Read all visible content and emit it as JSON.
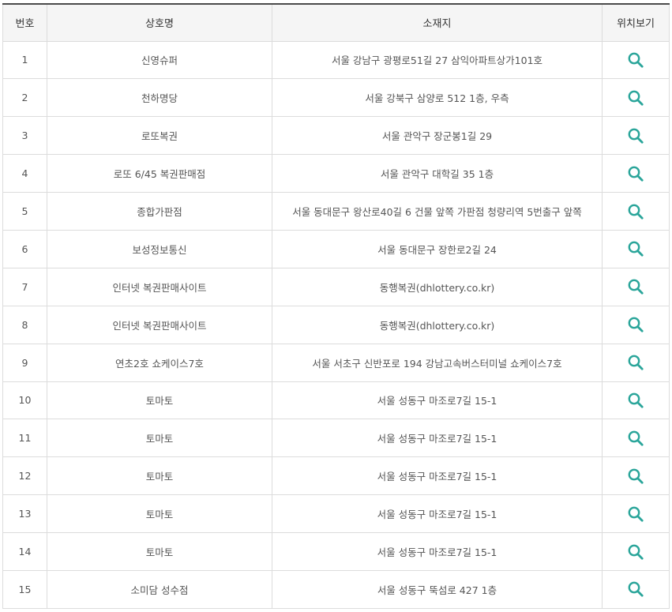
{
  "table": {
    "headers": {
      "no": "번호",
      "name": "상호명",
      "address": "소재지",
      "location": "위치보기"
    },
    "rows": [
      {
        "no": "1",
        "name": "신영슈퍼",
        "address": "서울 강남구 광평로51길 27 삼익아파트상가101호"
      },
      {
        "no": "2",
        "name": "천하명당",
        "address": "서울 강북구 삼양로 512 1층, 우측"
      },
      {
        "no": "3",
        "name": "로또복권",
        "address": "서울 관악구 장군봉1길 29"
      },
      {
        "no": "4",
        "name": "로또 6/45 복권판매점",
        "address": "서울 관악구 대학길 35 1층"
      },
      {
        "no": "5",
        "name": "종합가판점",
        "address": "서울 동대문구 왕산로40길 6 건물 앞쪽 가판점 청량리역 5번출구 앞쪽"
      },
      {
        "no": "6",
        "name": "보성정보통신",
        "address": "서울 동대문구 장한로2길 24"
      },
      {
        "no": "7",
        "name": "인터넷 복권판매사이트",
        "address": "동행복권(dhlottery.co.kr)"
      },
      {
        "no": "8",
        "name": "인터넷 복권판매사이트",
        "address": "동행복권(dhlottery.co.kr)"
      },
      {
        "no": "9",
        "name": "연초2호 쇼케이스7호",
        "address": "서울 서초구 신반포로 194 강남고속버스터미널 쇼케이스7호"
      },
      {
        "no": "10",
        "name": "토마토",
        "address": "서울 성동구 마조로7길 15-1"
      },
      {
        "no": "11",
        "name": "토마토",
        "address": "서울 성동구 마조로7길 15-1"
      },
      {
        "no": "12",
        "name": "토마토",
        "address": "서울 성동구 마조로7길 15-1"
      },
      {
        "no": "13",
        "name": "토마토",
        "address": "서울 성동구 마조로7길 15-1"
      },
      {
        "no": "14",
        "name": "토마토",
        "address": "서울 성동구 마조로7길 15-1"
      },
      {
        "no": "15",
        "name": "소미담 성수점",
        "address": "서울 성동구 뚝섬로 427 1층"
      }
    ]
  },
  "icons": {
    "location": "search-icon"
  },
  "colors": {
    "accent": "#2aa59a",
    "header_border": "#4a4a4a",
    "grid": "#dcdcdc",
    "header_bg": "#f5f5f5"
  }
}
